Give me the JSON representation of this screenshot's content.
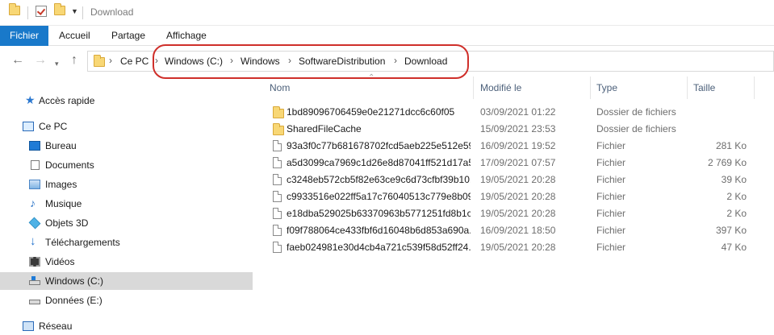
{
  "window": {
    "title": "Download"
  },
  "ribbon": {
    "tabs": [
      "Fichier",
      "Accueil",
      "Partage",
      "Affichage"
    ]
  },
  "address": {
    "breadcrumbs": [
      "Ce PC",
      "Windows (C:)",
      "Windows",
      "SoftwareDistribution",
      "Download"
    ]
  },
  "nav_pane": {
    "items": [
      {
        "label": "Accès rapide",
        "icon": "star-icon"
      },
      {
        "label": "Ce PC",
        "icon": "computer-icon"
      },
      {
        "label": "Bureau",
        "icon": "desktop-icon"
      },
      {
        "label": "Documents",
        "icon": "document-icon"
      },
      {
        "label": "Images",
        "icon": "pictures-icon"
      },
      {
        "label": "Musique",
        "icon": "music-icon"
      },
      {
        "label": "Objets 3D",
        "icon": "3d-objects-icon"
      },
      {
        "label": "Téléchargements",
        "icon": "download-icon"
      },
      {
        "label": "Vidéos",
        "icon": "video-icon"
      },
      {
        "label": "Windows (C:)",
        "icon": "drive-icon",
        "selected": true
      },
      {
        "label": "Données (E:)",
        "icon": "drive-icon"
      },
      {
        "label": "Réseau",
        "icon": "network-icon"
      }
    ]
  },
  "details": {
    "columns": [
      "Nom",
      "Modifié le",
      "Type",
      "Taille"
    ],
    "rows": [
      {
        "name": "1bd89096706459e0e21271dcc6c60f05",
        "date": "03/09/2021 01:22",
        "type": "Dossier de fichiers",
        "size": "",
        "kind": "folder"
      },
      {
        "name": "SharedFileCache",
        "date": "15/09/2021 23:53",
        "type": "Dossier de fichiers",
        "size": "",
        "kind": "folder"
      },
      {
        "name": "93a3f0c77b681678702fcd5aeb225e512e59...",
        "date": "16/09/2021 19:52",
        "type": "Fichier",
        "size": "281 Ko",
        "kind": "file"
      },
      {
        "name": "a5d3099ca7969c1d26e8d87041ff521d17a5...",
        "date": "17/09/2021 07:57",
        "type": "Fichier",
        "size": "2 769 Ko",
        "kind": "file"
      },
      {
        "name": "c3248eb572cb5f82e63ce9c6d73cfbf39b10...",
        "date": "19/05/2021 20:28",
        "type": "Fichier",
        "size": "39 Ko",
        "kind": "file"
      },
      {
        "name": "c9933516e022ff5a17c76040513c779e8b09...",
        "date": "19/05/2021 20:28",
        "type": "Fichier",
        "size": "2 Ko",
        "kind": "file"
      },
      {
        "name": "e18dba529025b63370963b5771251fd8b1c...",
        "date": "19/05/2021 20:28",
        "type": "Fichier",
        "size": "2 Ko",
        "kind": "file"
      },
      {
        "name": "f09f788064ce433fbf6d16048b6d853a690a...",
        "date": "16/09/2021 18:50",
        "type": "Fichier",
        "size": "397 Ko",
        "kind": "file"
      },
      {
        "name": "faeb024981e30d4cb4a721c539f58d52ff24...",
        "date": "19/05/2021 20:28",
        "type": "Fichier",
        "size": "47 Ko",
        "kind": "file"
      }
    ]
  },
  "colors": {
    "accent": "#1979ca",
    "annotation": "#cf2f2a",
    "selected": "#d9d9d9"
  }
}
